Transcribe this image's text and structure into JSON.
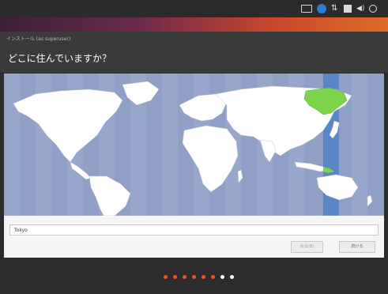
{
  "window": {
    "title": "インストール (as superuser)"
  },
  "page": {
    "title": "どこに住んでいますか？"
  },
  "panel": {
    "indicators": [
      "keyboard-icon",
      "accessibility-icon",
      "network-icon",
      "battery-icon",
      "sound-icon",
      "power-icon"
    ]
  },
  "timezone": {
    "value": "Tokyo",
    "highlight_color": "#7cd44c",
    "band_color": "#5b86c6"
  },
  "buttons": {
    "back_label": "戻る(B)",
    "continue_label": "続ける"
  },
  "progress": {
    "completed_steps": 6,
    "total_steps": 8,
    "accent_color": "#e95420"
  }
}
